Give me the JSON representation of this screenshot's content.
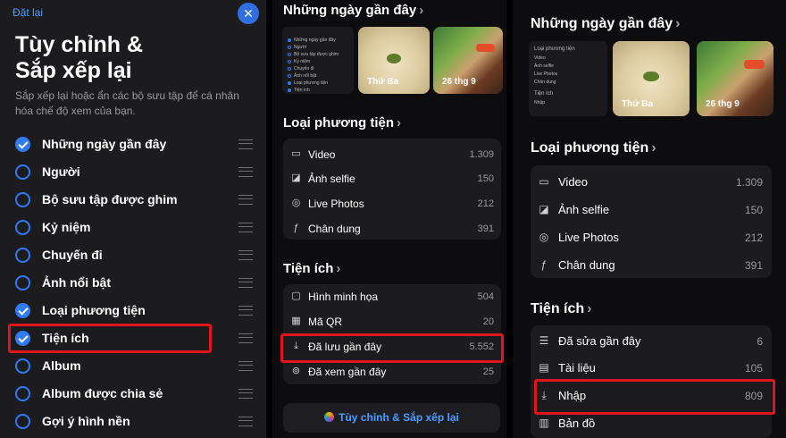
{
  "customize": {
    "reset_label": "Đặt lại",
    "close_icon": "✕",
    "title_line1": "Tùy chỉnh &",
    "title_line2": "Sắp xếp lại",
    "description": "Sắp xếp lại hoặc ẩn các bộ sưu tập để cá nhân hóa chế độ xem của bạn.",
    "items": [
      {
        "label": "Những ngày gần đây",
        "checked": true
      },
      {
        "label": "Người",
        "checked": false
      },
      {
        "label": "Bộ sưu tập được ghim",
        "checked": false
      },
      {
        "label": "Kỷ niệm",
        "checked": false
      },
      {
        "label": "Chuyến đi",
        "checked": false
      },
      {
        "label": "Ảnh nổi bật",
        "checked": false
      },
      {
        "label": "Loại phương tiện",
        "checked": true
      },
      {
        "label": "Tiện ích",
        "checked": true
      },
      {
        "label": "Album",
        "checked": false
      },
      {
        "label": "Album được chia sẻ",
        "checked": false
      },
      {
        "label": "Gợi ý hình nền",
        "checked": false
      }
    ]
  },
  "panel2": {
    "recent_days_title": "Những ngày gần đây",
    "thumb_labels": [
      "Thứ Ba",
      "26 thg 9"
    ],
    "mini_list": {
      "items": [
        "Những ngày gần đây",
        "Người",
        "Bộ sưu tập được ghim",
        "Kỷ niệm",
        "Chuyến đi",
        "Ảnh nổi bật",
        "Loại phương tiện",
        "Tiện ích"
      ]
    },
    "media_types_title": "Loại phương tiện",
    "media_types": [
      {
        "icon": "video-icon",
        "label": "Video",
        "count": "1.309"
      },
      {
        "icon": "selfie-icon",
        "label": "Ảnh selfie",
        "count": "150"
      },
      {
        "icon": "live-photos-icon",
        "label": "Live Photos",
        "count": "212"
      },
      {
        "icon": "portrait-icon",
        "label": "Chân dung",
        "count": "391"
      }
    ],
    "utilities_title": "Tiện ích",
    "utilities": [
      {
        "icon": "illustration-icon",
        "label": "Hình minh họa",
        "count": "504"
      },
      {
        "icon": "qr-icon",
        "label": "Mã QR",
        "count": "20"
      },
      {
        "icon": "import-icon",
        "label": "Đã lưu gần đây",
        "count": "5.552"
      },
      {
        "icon": "recently-viewed-icon",
        "label": "Đã xem gần đây",
        "count": "25"
      }
    ],
    "customize_button": "Tùy chỉnh & Sắp xếp lại"
  },
  "panel3": {
    "recent_days_title": "Những ngày gần đây",
    "mini_title": "Loại phương tiện",
    "mini_media": [
      "Video",
      "Ảnh selfie",
      "Live Photos",
      "Chân dung"
    ],
    "mini_util_title": "Tiện ích",
    "mini_util": [
      "Nhập"
    ],
    "thumb_labels": [
      "Thứ Ba",
      "26 thg 9"
    ],
    "media_types_title": "Loại phương tiện",
    "media_types": [
      {
        "icon": "video-icon",
        "label": "Video",
        "count": "1.309"
      },
      {
        "icon": "selfie-icon",
        "label": "Ảnh selfie",
        "count": "150"
      },
      {
        "icon": "live-photos-icon",
        "label": "Live Photos",
        "count": "212"
      },
      {
        "icon": "portrait-icon",
        "label": "Chân dung",
        "count": "391"
      }
    ],
    "utilities_title": "Tiện ích",
    "utilities": [
      {
        "icon": "recently-edited-icon",
        "label": "Đã sửa gần đây",
        "count": "6"
      },
      {
        "icon": "documents-icon",
        "label": "Tài liệu",
        "count": "105"
      },
      {
        "icon": "import-icon",
        "label": "Nhập",
        "count": "809"
      },
      {
        "icon": "map-icon",
        "label": "Bản đồ",
        "count": ""
      }
    ]
  },
  "colors": {
    "accent": "#2f7bf5",
    "highlight": "#e0161c",
    "panel_bg": "#1c1c1e"
  }
}
